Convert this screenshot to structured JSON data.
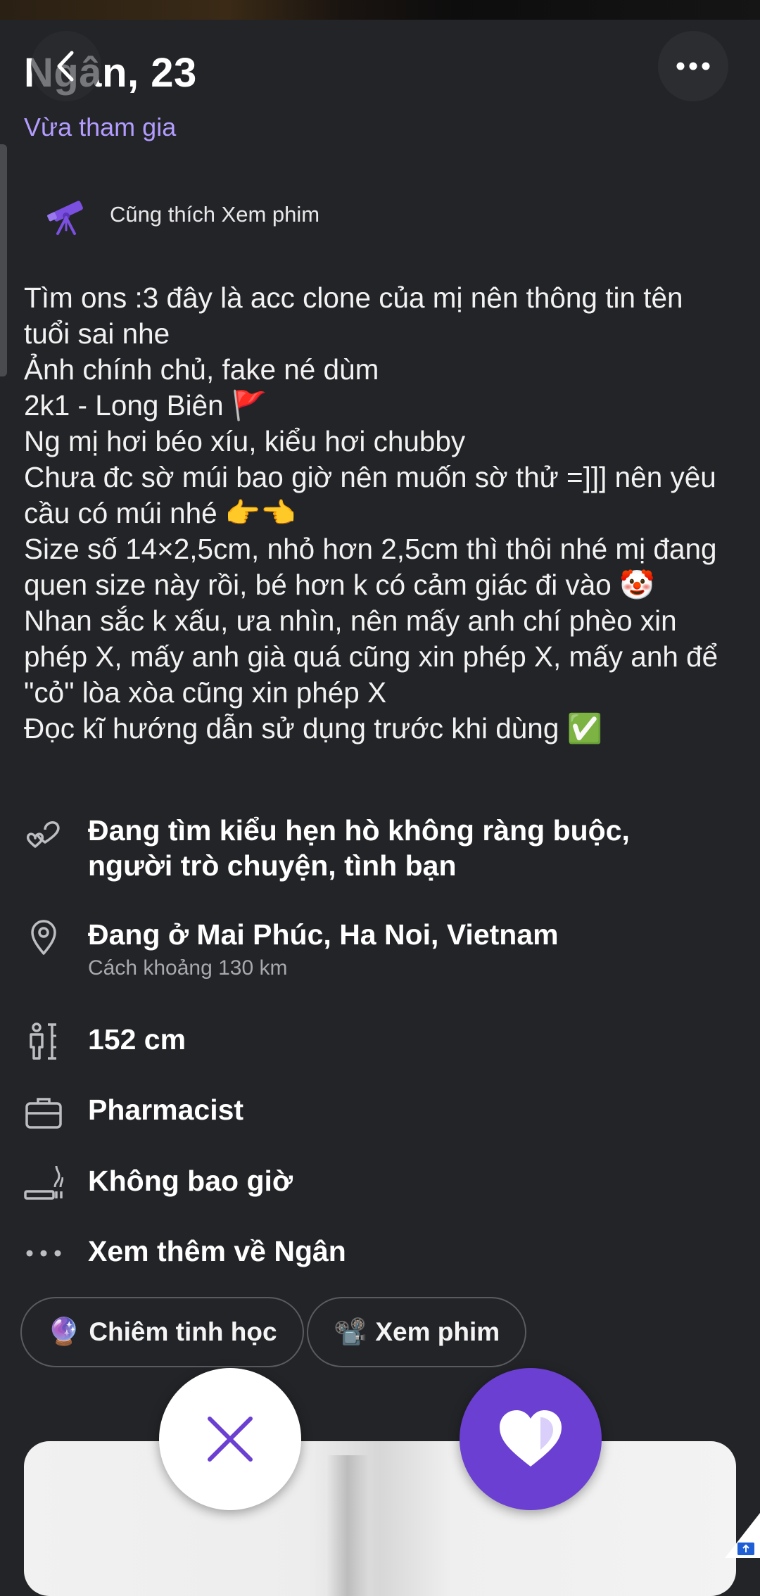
{
  "profile": {
    "name_age": "Ngân, 23",
    "joined_status": "Vừa tham gia",
    "shared_interest": "Cũng thích Xem phim",
    "bio": "Tìm ons :3 đây là acc clone của mị nên thông tin tên tuổi sai nhe\nẢnh chính chủ, fake né dùm\n2k1 - Long Biên 🚩\nNg mị hơi béo xíu, kiểu hơi chubby\nChưa đc sờ múi bao giờ nên muốn sờ thử =]]] nên yêu cầu có múi nhé 👉👈\nSize số 14×2,5cm, nhỏ hơn 2,5cm thì thôi nhé mị đang quen size này rồi, bé hơn k có cảm giác đi vào 🤡\nNhan sắc k xấu, ưa nhìn, nên mấy anh chí phèo xin phép X, mấy anh già quá cũng xin phép X, mấy anh để \"cỏ\" lòa xòa cũng xin phép X\nĐọc kĩ hướng dẫn sử dụng trước khi dùng ✅"
  },
  "details": {
    "looking_for": "Đang tìm kiểu hẹn hò không ràng buộc, người trò chuyện, tình bạn",
    "location": "Đang ở Mai Phúc, Ha Noi, Vietnam",
    "distance": "Cách  khoảng 130 km",
    "height": "152 cm",
    "job": "Pharmacist",
    "smoking": "Không bao giờ",
    "see_more": "Xem thêm về Ngân"
  },
  "interests": [
    {
      "emoji": "🔮",
      "label": "Chiêm tinh học"
    },
    {
      "emoji": "📽️",
      "label": "Xem phim"
    }
  ],
  "icons": {
    "back": "chevron-left-icon",
    "more": "more-horizontal-icon",
    "shared_interest": "telescope-icon",
    "looking_for": "hearts-icon",
    "location": "location-pin-icon",
    "height": "height-icon",
    "job": "briefcase-icon",
    "smoking": "smoking-icon",
    "see_more": "dots-icon",
    "pass": "close-icon",
    "like": "heart-icon"
  },
  "colors": {
    "background": "#232427",
    "accent": "#6a3fd1",
    "joined_text": "#b39cff"
  }
}
